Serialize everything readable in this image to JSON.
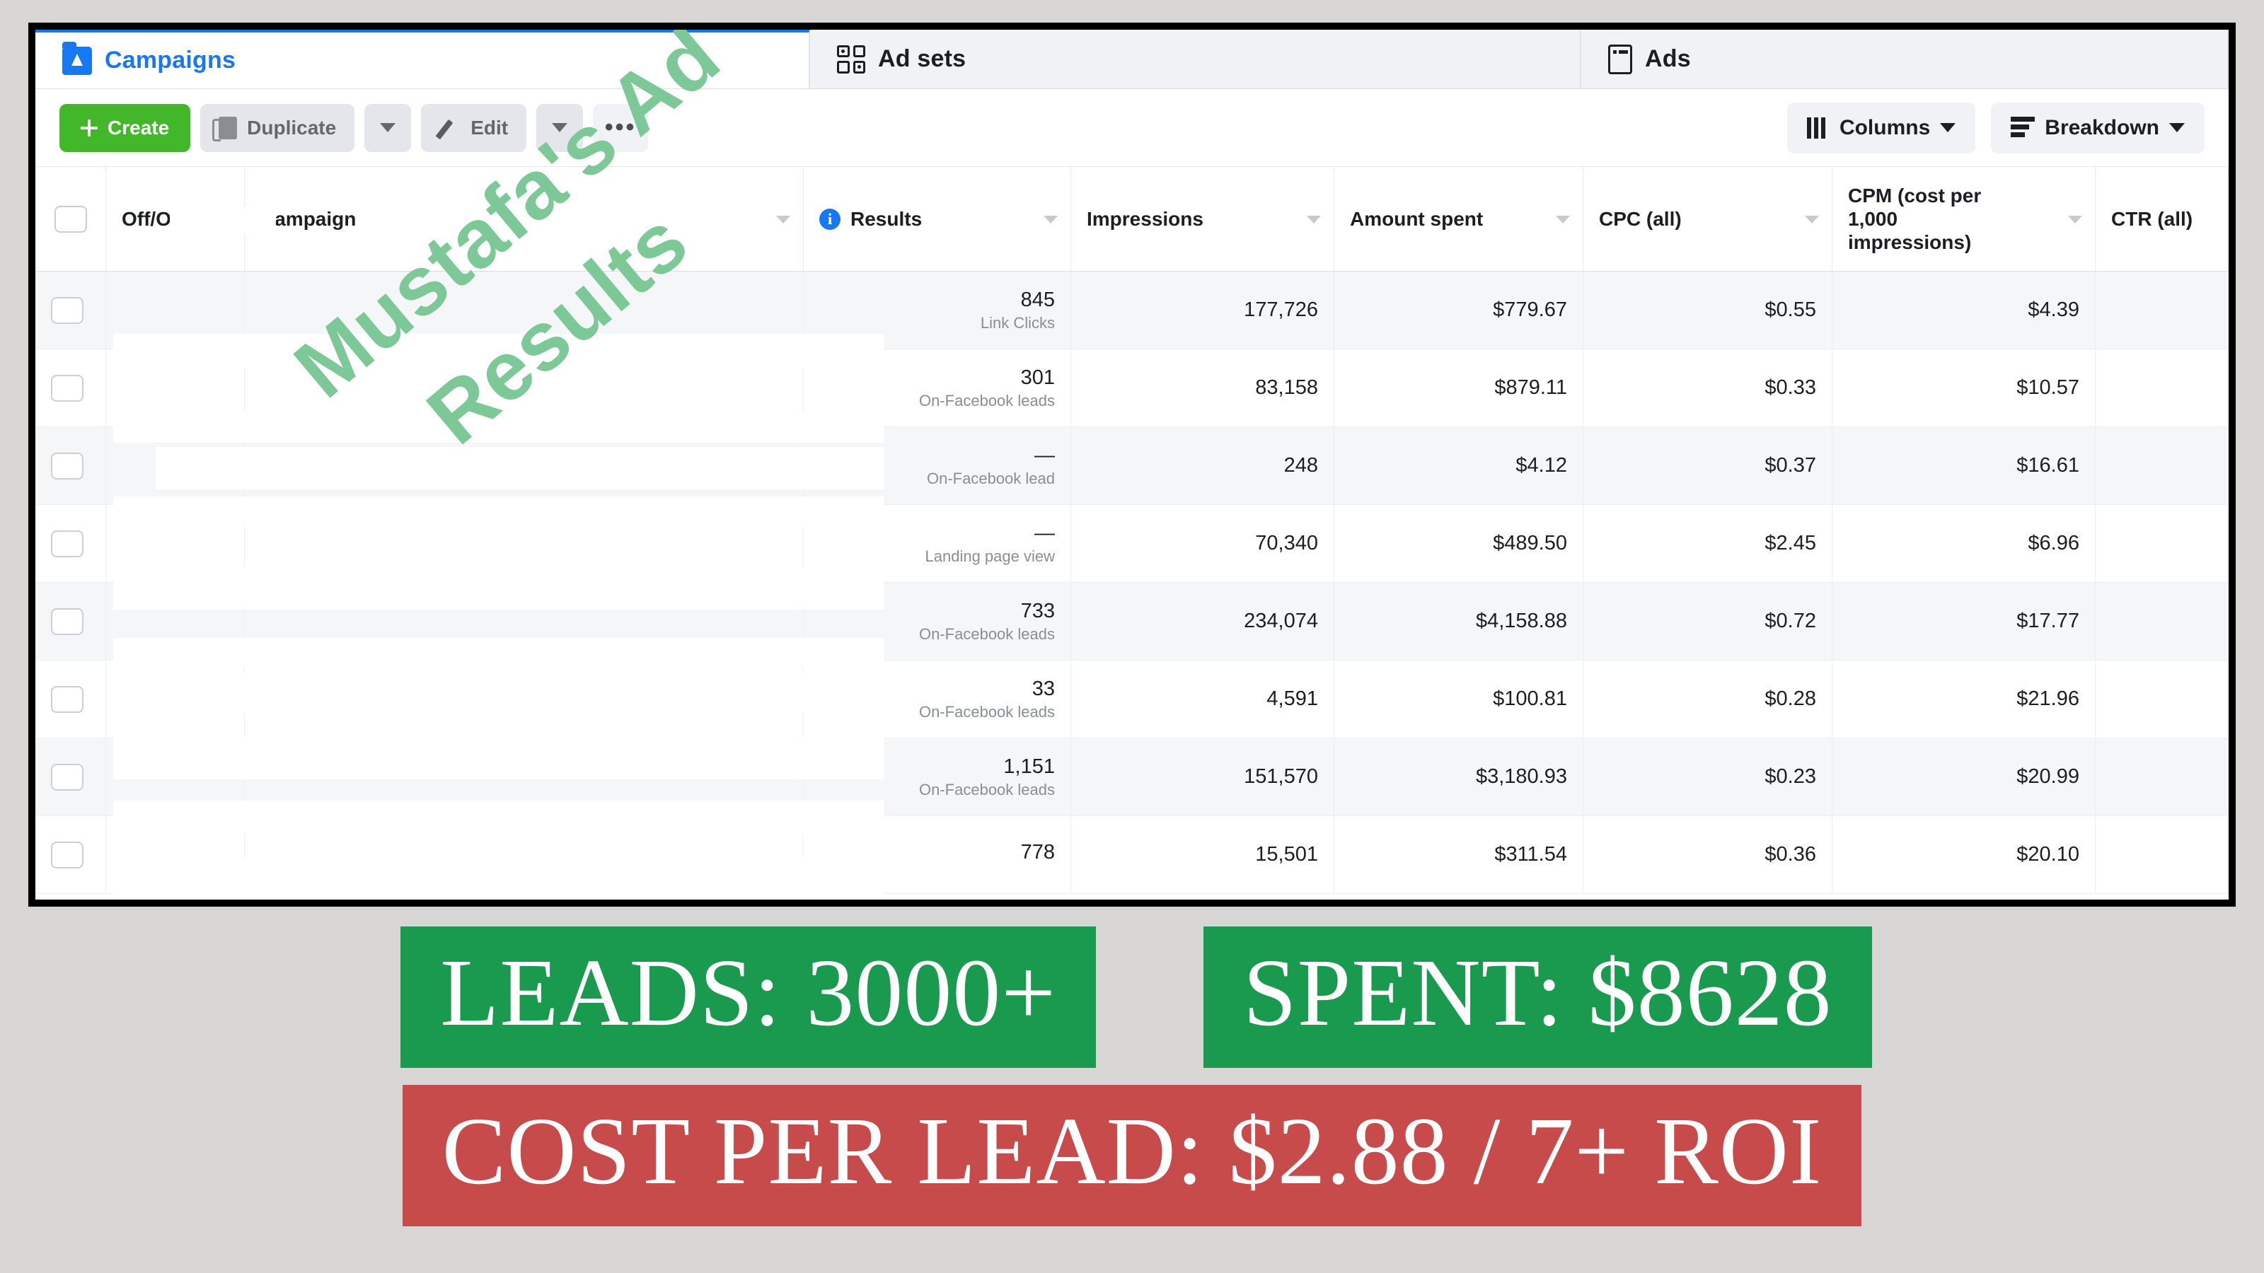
{
  "tabs": [
    {
      "label": "Campaigns",
      "icon": "campaign-folder-icon",
      "active": true
    },
    {
      "label": "Ad sets",
      "icon": "grid-2x2-icon",
      "active": false
    },
    {
      "label": "Ads",
      "icon": "ad-card-icon",
      "active": false
    }
  ],
  "toolbar": {
    "create_label": "Create",
    "duplicate_label": "Duplicate",
    "edit_label": "Edit",
    "more_label": "•••",
    "columns_label": "Columns",
    "breakdown_label": "Breakdown"
  },
  "table": {
    "columns": [
      {
        "key": "select",
        "label": ""
      },
      {
        "key": "offon",
        "label": "Off/On"
      },
      {
        "key": "campaign",
        "label": "Campaign"
      },
      {
        "key": "results",
        "label": "Results"
      },
      {
        "key": "impressions",
        "label": "Impressions"
      },
      {
        "key": "amount",
        "label": "Amount spent"
      },
      {
        "key": "cpc",
        "label": "CPC (all)"
      },
      {
        "key": "cpm",
        "label": "CPM (cost per 1,000 impressions)"
      },
      {
        "key": "ctr",
        "label": "CTR (all)"
      }
    ],
    "rows": [
      {
        "results": "845",
        "result_type": "Link Clicks",
        "impressions": "177,726",
        "amount": "$779.67",
        "cpc": "$0.55",
        "cpm": "$4.39",
        "ctr": ""
      },
      {
        "results": "301",
        "result_type": "On-Facebook leads",
        "impressions": "83,158",
        "amount": "$879.11",
        "cpc": "$0.33",
        "cpm": "$10.57",
        "ctr": ""
      },
      {
        "results": "—",
        "result_type": "On-Facebook lead",
        "impressions": "248",
        "amount": "$4.12",
        "cpc": "$0.37",
        "cpm": "$16.61",
        "ctr": ""
      },
      {
        "results": "—",
        "result_type": "Landing page view",
        "impressions": "70,340",
        "amount": "$489.50",
        "cpc": "$2.45",
        "cpm": "$6.96",
        "ctr": ""
      },
      {
        "results": "733",
        "result_type": "On-Facebook leads",
        "impressions": "234,074",
        "amount": "$4,158.88",
        "cpc": "$0.72",
        "cpm": "$17.77",
        "ctr": ""
      },
      {
        "results": "33",
        "result_type": "On-Facebook leads",
        "impressions": "4,591",
        "amount": "$100.81",
        "cpc": "$0.28",
        "cpm": "$21.96",
        "ctr": ""
      },
      {
        "results": "1,151",
        "result_type": "On-Facebook leads",
        "impressions": "151,570",
        "amount": "$3,180.93",
        "cpc": "$0.23",
        "cpm": "$20.99",
        "ctr": ""
      },
      {
        "results": "778",
        "result_type": "",
        "impressions": "15,501",
        "amount": "$311.54",
        "cpc": "$0.36",
        "cpm": "$20.10",
        "ctr": ""
      }
    ]
  },
  "watermark": {
    "text": "Mustafa's Ad\n   Results",
    "color": "#7cc896"
  },
  "banners": {
    "leads": "LEADS: 3000+",
    "spent": "SPENT: $8628",
    "cost_per_lead": "COST PER LEAD: $2.88 / 7+ ROI",
    "green": "#199a4f",
    "red": "#c84b4b"
  }
}
